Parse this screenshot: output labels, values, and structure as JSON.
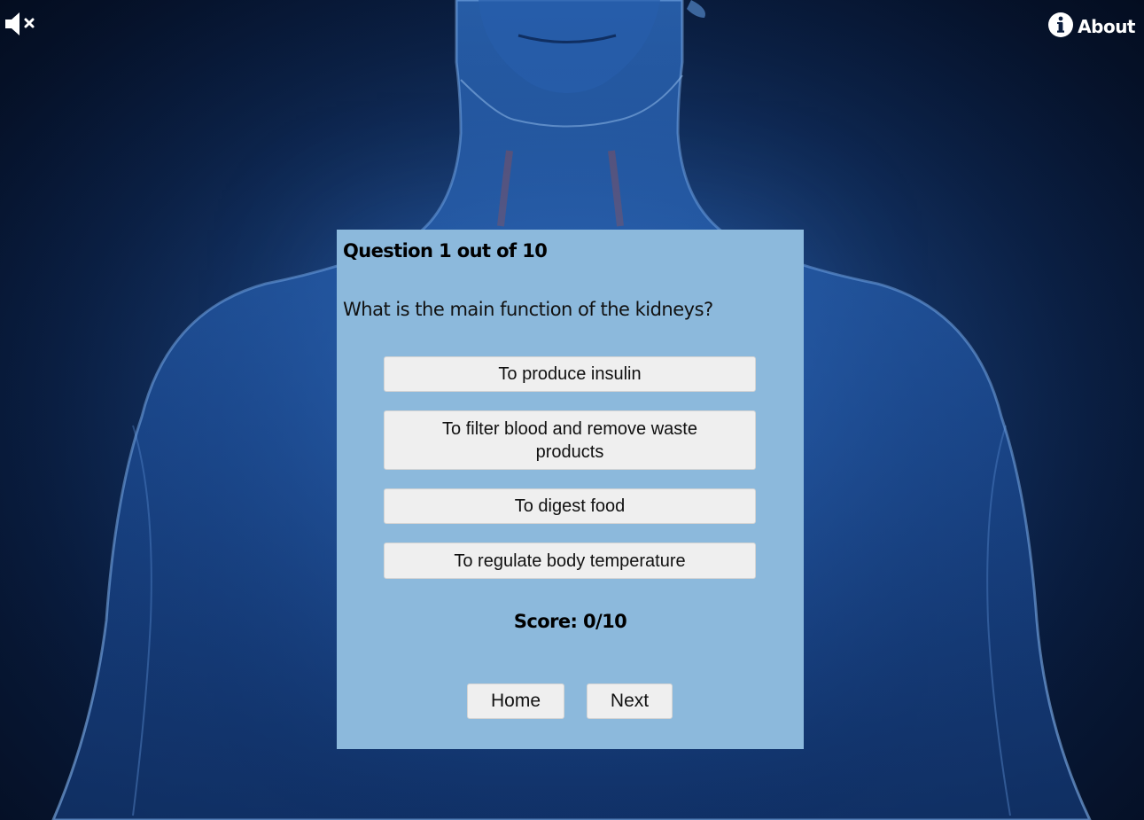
{
  "header": {
    "about_label": "About"
  },
  "icons": {
    "mute": "speaker-muted-icon",
    "about": "info-icon"
  },
  "quiz": {
    "counter": "Question 1 out of 10",
    "question": "What is the main function of the kidneys?",
    "answers": [
      "To produce insulin",
      "To filter blood and remove waste products",
      "To digest food",
      "To regulate body temperature"
    ],
    "score": "Score: 0/10",
    "home_label": "Home",
    "next_label": "Next"
  },
  "colors": {
    "panel": "#8cb9dc",
    "button": "#efefef",
    "background": "#0f2a57"
  }
}
